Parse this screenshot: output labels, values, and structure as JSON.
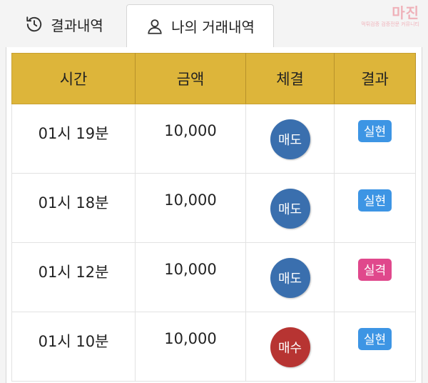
{
  "tabs": [
    {
      "label": "결과내역",
      "icon": "history-icon",
      "active": false
    },
    {
      "label": "나의 거래내역",
      "icon": "user-icon",
      "active": true
    }
  ],
  "watermark": {
    "title": "마진",
    "subtitle": "먹튀검증 검증전문 커뮤니티"
  },
  "table": {
    "headers": [
      "시간",
      "금액",
      "체결",
      "결과"
    ],
    "rows": [
      {
        "time": "01시 19분",
        "amount": "10,000",
        "trade": "매도",
        "result": "실현"
      },
      {
        "time": "01시 18분",
        "amount": "10,000",
        "trade": "매도",
        "result": "실현"
      },
      {
        "time": "01시 12분",
        "amount": "10,000",
        "trade": "매도",
        "result": "실격"
      },
      {
        "time": "01시 10분",
        "amount": "10,000",
        "trade": "매수",
        "result": "실현"
      }
    ]
  },
  "colors": {
    "header_bg": "#ddb53a",
    "sell": "#3a6fae",
    "buy": "#b73432",
    "result_ok": "#3d95e4",
    "result_fail": "#e0488c"
  }
}
